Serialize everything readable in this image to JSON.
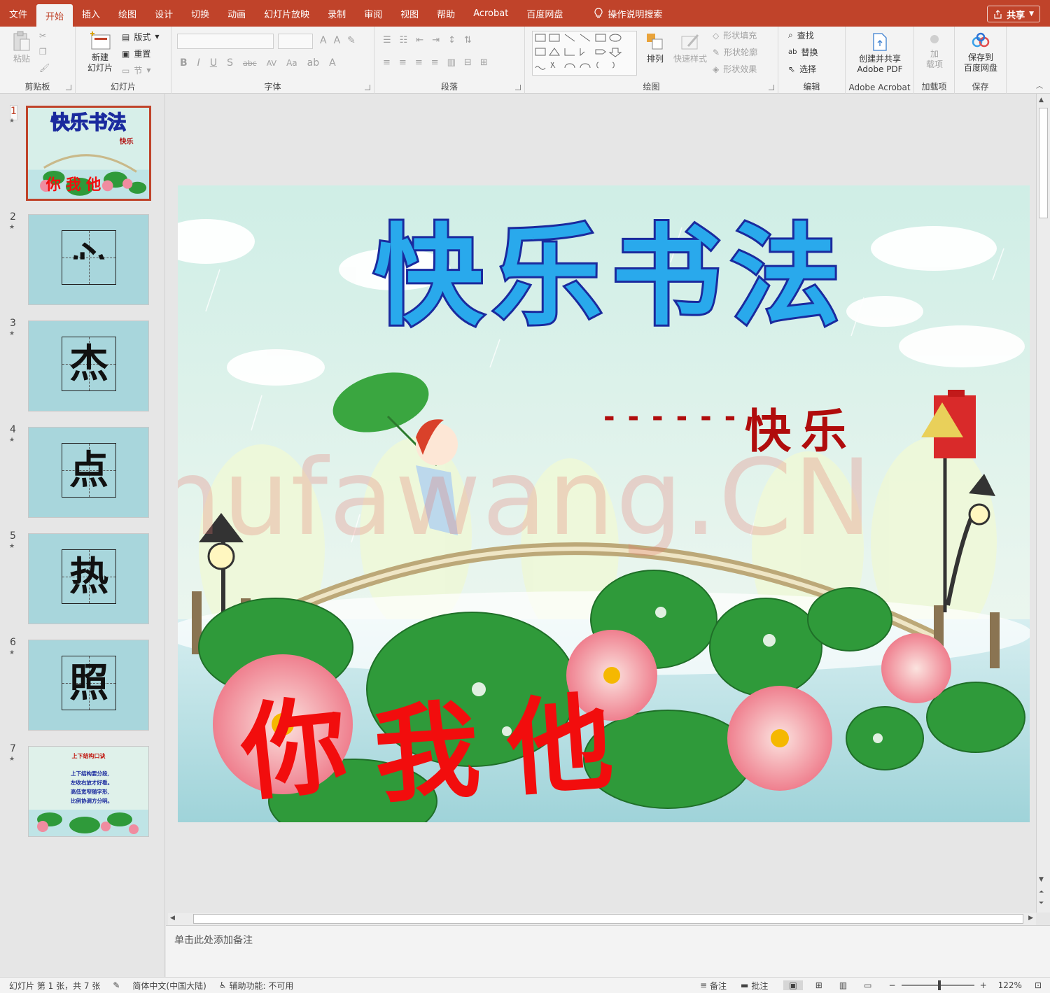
{
  "tabs": [
    {
      "label": "文件"
    },
    {
      "label": "开始",
      "active": true
    },
    {
      "label": "插入"
    },
    {
      "label": "绘图"
    },
    {
      "label": "设计"
    },
    {
      "label": "切换"
    },
    {
      "label": "动画"
    },
    {
      "label": "幻灯片放映"
    },
    {
      "label": "录制"
    },
    {
      "label": "审阅"
    },
    {
      "label": "视图"
    },
    {
      "label": "帮助"
    },
    {
      "label": "Acrobat"
    },
    {
      "label": "百度网盘"
    }
  ],
  "search": {
    "label": "操作说明搜索",
    "icon": "lightbulb-icon"
  },
  "share": {
    "label": "共享"
  },
  "ribbon": {
    "clipboard": {
      "group": "剪贴板",
      "paste": "粘贴"
    },
    "slides": {
      "group": "幻灯片",
      "new_slide_1": "新建",
      "new_slide_2": "幻灯片",
      "layout": "版式",
      "reset": "重置",
      "section": "节"
    },
    "font": {
      "group": "字体"
    },
    "paragraph": {
      "group": "段落"
    },
    "drawing": {
      "group": "绘图",
      "arrange": "排列",
      "quick_styles": "快速样式",
      "fill": "形状填充",
      "outline": "形状轮廓",
      "effects": "形状效果"
    },
    "editing": {
      "group": "编辑",
      "find": "查找",
      "replace": "替换",
      "select": "选择"
    },
    "acrobat": {
      "group": "Adobe Acrobat",
      "line1": "创建并共享",
      "line2": "Adobe PDF"
    },
    "addins": {
      "group": "加载项",
      "line1": "加",
      "line2": "载项"
    },
    "save": {
      "group": "保存",
      "line1": "保存到",
      "line2": "百度网盘"
    }
  },
  "thumbnails": [
    {
      "num": "1"
    },
    {
      "num": "2",
      "char": "心"
    },
    {
      "num": "3",
      "char": "杰"
    },
    {
      "num": "4",
      "char": "点"
    },
    {
      "num": "5",
      "char": "热"
    },
    {
      "num": "6",
      "char": "照"
    },
    {
      "num": "7",
      "title": "上下结构口诀",
      "lines": [
        "上下结构要分段,",
        "左收右放才好看。",
        "高低宽窄随字形,",
        "比例协调方分明。"
      ]
    }
  ],
  "slide": {
    "title": "快乐书法",
    "subtitle_dashes": "- - - - - -",
    "subtitle": "快乐",
    "bottom_chars": [
      "你",
      "我",
      "他"
    ],
    "watermark": "Shufawang.CN"
  },
  "notes": {
    "placeholder": "单击此处添加备注"
  },
  "status": {
    "slide_info": "幻灯片 第 1 张，共 7 张",
    "language": "简体中文(中国大陆)",
    "accessibility": "辅助功能: 不可用",
    "notes_btn": "备注",
    "comments_btn": "批注",
    "zoom": "122%"
  },
  "colors": {
    "accent": "#c0432a",
    "title_fill": "#29a9ec",
    "title_stroke": "#1a2a9e",
    "subtitle": "#b00c0c",
    "bottom_chars": "#f20d0d"
  }
}
